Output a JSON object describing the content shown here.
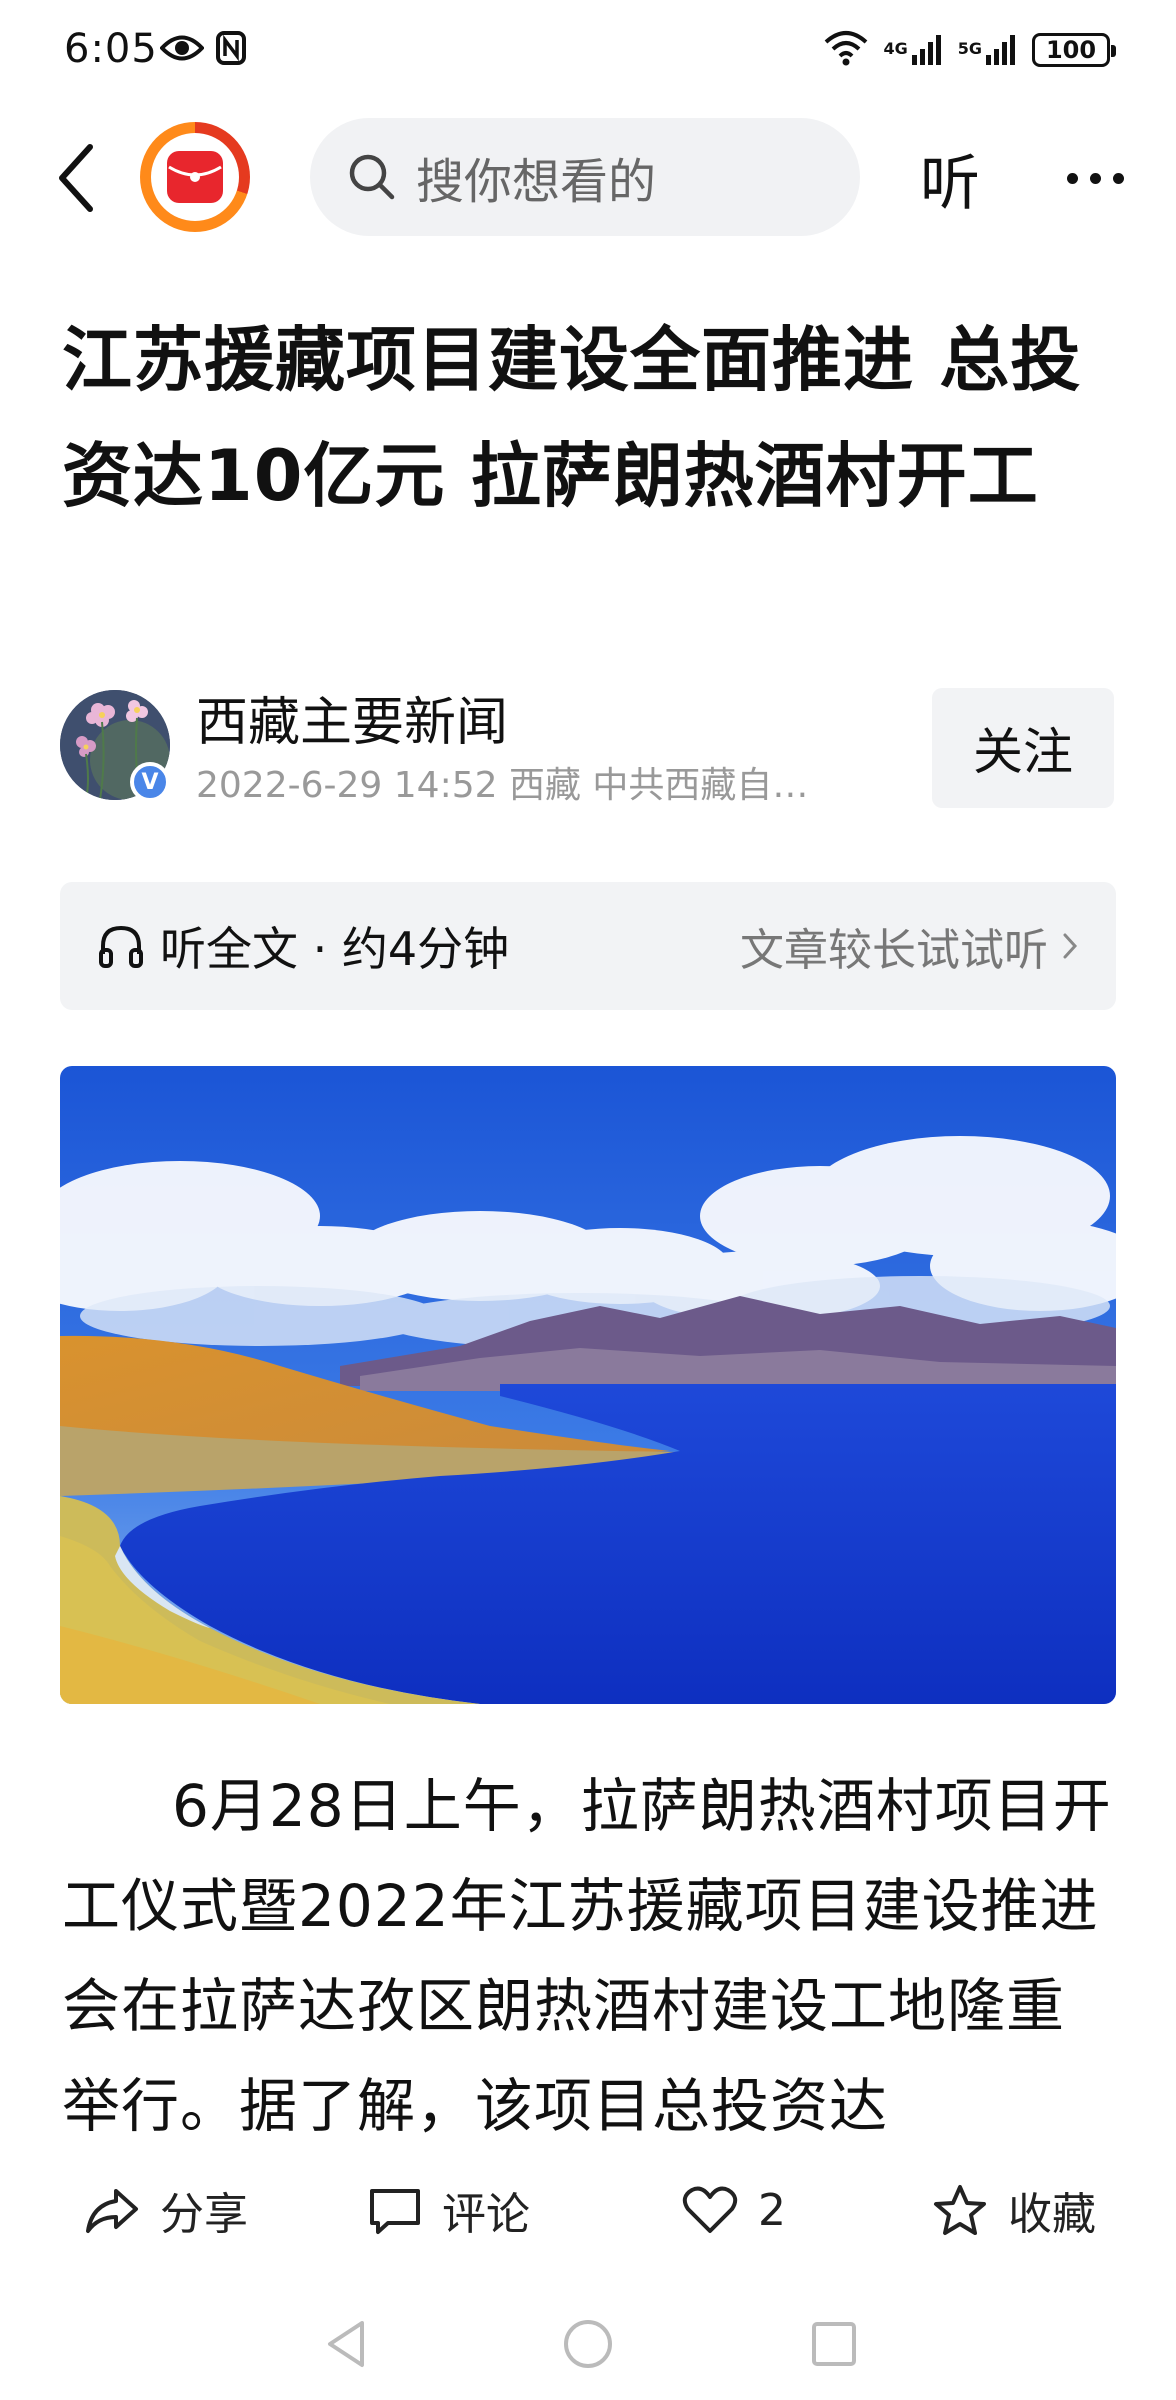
{
  "status_bar": {
    "time": "6:05",
    "network_left": "4G",
    "network_right": "5G",
    "battery": "100"
  },
  "nav": {
    "search_placeholder": "搜你想看的",
    "listen_label": "听"
  },
  "article": {
    "headline": "江苏援藏项目建设全面推进 总投资达10亿元 拉萨朗热酒村开工",
    "author": "西藏主要新闻",
    "verified_mark": "V",
    "meta": "2022-6-29  14:52  西藏  中共西藏自…",
    "follow_label": "关注",
    "body": "6月28日上午，拉萨朗热酒村项目开工仪式暨2022年江苏援藏项目建设推进会在拉萨达孜区朗热酒村建设工地隆重举行。据了解，该项目总投资达"
  },
  "listen_bar": {
    "left": "听全文 · 约4分钟",
    "right": "文章较长试试听"
  },
  "actions": {
    "share": "分享",
    "comment": "评论",
    "like_count": "2",
    "favorite": "收藏"
  },
  "colors": {
    "accent_orange": "#ff8a1a",
    "accent_red": "#e53a1f",
    "verified_blue": "#4a86e8",
    "panel_gray": "#f2f3f5"
  }
}
